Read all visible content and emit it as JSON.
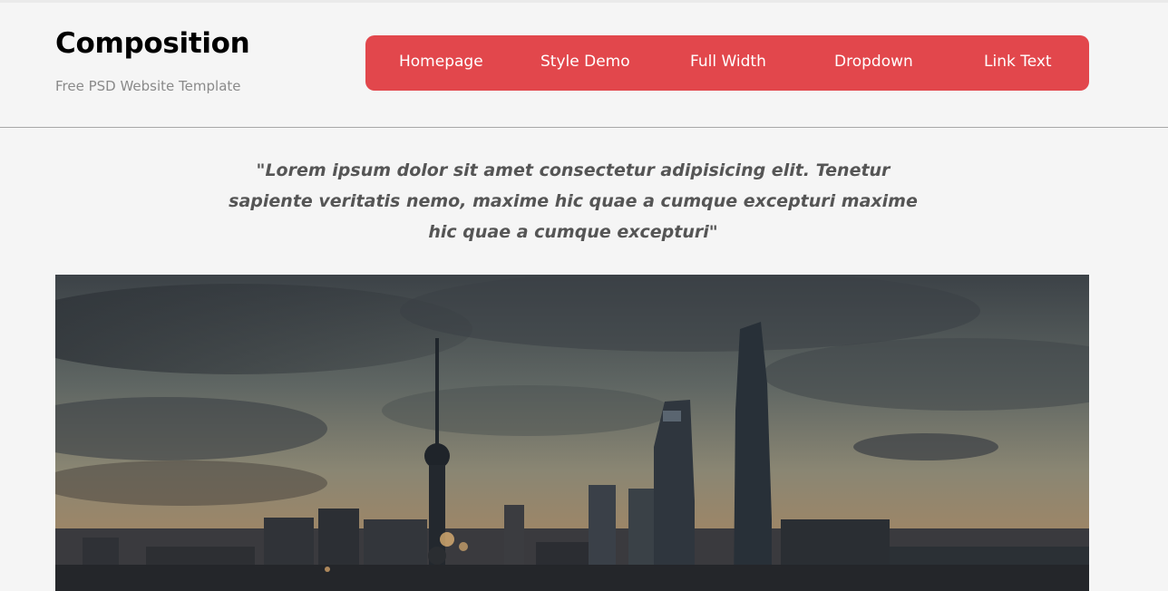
{
  "site": {
    "title": "Composition",
    "tagline": "Free PSD Website Template"
  },
  "nav": {
    "items": [
      {
        "label": "Homepage"
      },
      {
        "label": "Style Demo"
      },
      {
        "label": "Full Width"
      },
      {
        "label": "Dropdown"
      },
      {
        "label": "Link Text"
      }
    ],
    "color": "#e2474c"
  },
  "quote": {
    "text": "\"Lorem ipsum dolor sit amet consectetur adipisicing elit. Tenetur sapiente veritatis nemo, maxime hic quae a cumque excepturi maxime hic quae a cumque excepturi\""
  },
  "hero": {
    "image": "city-skyline-at-dusk"
  }
}
